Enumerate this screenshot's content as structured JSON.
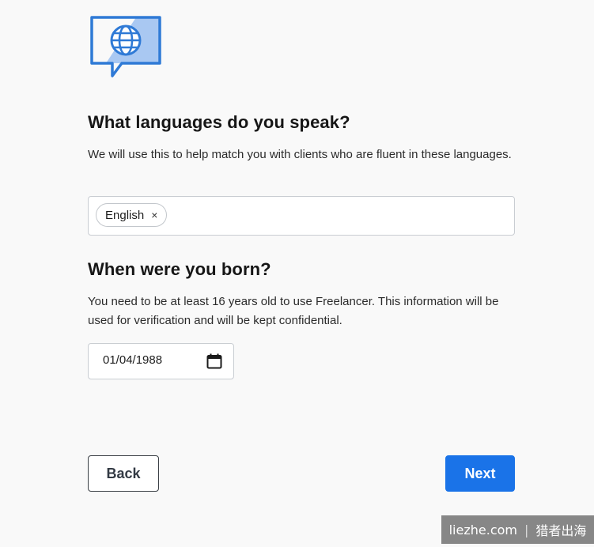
{
  "languages": {
    "heading": "What languages do you speak?",
    "description": "We will use this to help match you with clients who are fluent in these languages.",
    "selected": [
      {
        "label": "English",
        "remove_glyph": "×"
      }
    ]
  },
  "birth": {
    "heading": "When were you born?",
    "description": "You need to be at least 16 years old to use Freelancer. This information will be used for verification and will be kept confidential.",
    "date_value": "01/04/1988"
  },
  "actions": {
    "back_label": "Back",
    "next_label": "Next"
  },
  "watermark": {
    "site": "liezhe.com",
    "separator": "|",
    "brand": "猎者出海"
  },
  "icons": {
    "illustration": "speech-bubble-globe-icon",
    "calendar": "calendar-icon"
  },
  "colors": {
    "accent": "#1a73e8",
    "illustration_stroke": "#2f7ad6",
    "illustration_fill": "#a9c8f2"
  }
}
